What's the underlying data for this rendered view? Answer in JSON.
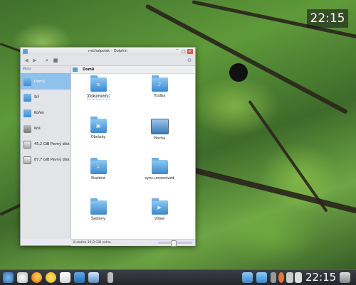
{
  "desktop": {
    "clock_widget": "22:15"
  },
  "window": {
    "title": "michalpolak – Dolphin",
    "toolbar_icons": [
      "back-icon",
      "forward-icon",
      "search-icon",
      "view-mode-icon"
    ],
    "sidebar": {
      "label": "Místa",
      "items": [
        {
          "label": "Domů",
          "icon": "home-folder-icon",
          "selected": true
        },
        {
          "label": "Síť",
          "icon": "network-folder-icon"
        },
        {
          "label": "Kořen",
          "icon": "root-folder-icon"
        },
        {
          "label": "Koš",
          "icon": "trash-icon"
        },
        {
          "label": "45,2 GiB Pevný disk",
          "icon": "hard-disk-icon"
        },
        {
          "label": "87,7 GiB Pevný disk",
          "icon": "hard-disk-icon"
        }
      ]
    },
    "breadcrumb": "Domů",
    "files": [
      {
        "label": "Dokumenty",
        "glyph": "≡",
        "selected": true
      },
      {
        "label": "Hudba",
        "glyph": "♪"
      },
      {
        "label": "Obrázky",
        "glyph": "▣"
      },
      {
        "label": "Plocha",
        "glyph": ""
      },
      {
        "label": "Stažené",
        "glyph": "↓"
      },
      {
        "label": "sync-unresolved",
        "glyph": ""
      },
      {
        "label": "Šablony",
        "glyph": ""
      },
      {
        "label": "Videa",
        "glyph": "▶"
      }
    ],
    "status": "8 složek  39,9 GiB volno"
  },
  "panel": {
    "clock": "22:15",
    "launchers": [
      "kickoff-icon",
      "firefox-icon",
      "browser-icon",
      "chat-icon",
      "mail-icon",
      "media-player-icon",
      "system-monitor-icon",
      "device-icon"
    ],
    "tray": [
      "folder-icon",
      "folder-icon",
      "network-icon",
      "volume-icon",
      "battery-icon",
      "trash-icon"
    ]
  }
}
